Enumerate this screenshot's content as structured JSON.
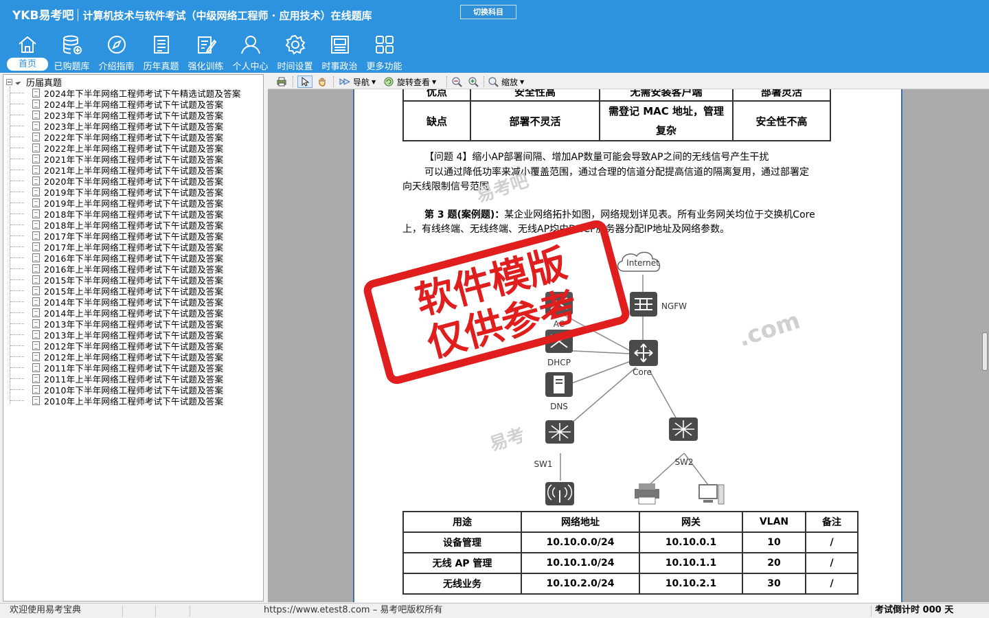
{
  "header": {
    "brand": "YKB易考吧",
    "title": "计算机技术与软件考试（中级网络工程师 · 应用技术）在线题库",
    "switch_label": "切换科目"
  },
  "nav": [
    {
      "label": "首页",
      "icon": "home-icon",
      "active": true
    },
    {
      "label": "已购题库",
      "icon": "database-icon"
    },
    {
      "label": "介绍指南",
      "icon": "compass-icon"
    },
    {
      "label": "历年真题",
      "icon": "exam-list-icon"
    },
    {
      "label": "强化训练",
      "icon": "edit-icon"
    },
    {
      "label": "个人中心",
      "icon": "user-icon"
    },
    {
      "label": "时间设置",
      "icon": "gear-icon"
    },
    {
      "label": "时事政治",
      "icon": "news-icon"
    },
    {
      "label": "更多功能",
      "icon": "grid-icon"
    }
  ],
  "tree": {
    "root": "历届真题",
    "items": [
      "2024年下半年网络工程师考试下午精选试题及答案",
      "2024年上半年网络工程师考试下午试题及答案",
      "2023年下半年网络工程师考试下午试题及答案",
      "2023年上半年网络工程师考试下午试题及答案",
      "2022年下半年网络工程师考试下午试题及答案",
      "2022年上半年网络工程师考试下午试题及答案",
      "2021年下半年网络工程师考试下午试题及答案",
      "2021年上半年网络工程师考试下午试题及答案",
      "2020年下半年网络工程师考试下午试题及答案",
      "2019年下半年网络工程师考试下午试题及答案",
      "2019年上半年网络工程师考试下午试题及答案",
      "2018年下半年网络工程师考试下午试题及答案",
      "2018年上半年网络工程师考试下午试题及答案",
      "2017年下半年网络工程师考试下午试题及答案",
      "2017年上半年网络工程师考试下午试题及答案",
      "2016年下半年网络工程师考试下午试题及答案",
      "2016年上半年网络工程师考试下午试题及答案",
      "2015年下半年网络工程师考试下午试题及答案",
      "2015年上半年网络工程师考试下午试题及答案",
      "2014年下半年网络工程师考试下午试题及答案",
      "2014年上半年网络工程师考试下午试题及答案",
      "2013年下半年网络工程师考试下午试题及答案",
      "2013年上半年网络工程师考试下午试题及答案",
      "2012年下半年网络工程师考试下午试题及答案",
      "2012年上半年网络工程师考试下午试题及答案",
      "2011年下半年网络工程师考试下午试题及答案",
      "2011年上半年网络工程师考试下午试题及答案",
      "2010年下半年网络工程师考试下午试题及答案",
      "2010年上半年网络工程师考试下午试题及答案"
    ]
  },
  "toolbar": {
    "nav_label": "导航",
    "rotate_label": "旋转查看",
    "zoom_label": "缩放"
  },
  "doc": {
    "compare_table": {
      "rows": [
        [
          "优点",
          "安全性高",
          "无需安装客户端",
          "部署灵活"
        ],
        [
          "缺点",
          "部署不灵活",
          "需登记 MAC 地址，管理复杂",
          "安全性不高"
        ]
      ]
    },
    "q4_line1": "【问题 4】缩小AP部署间隔、增加AP数量可能会导致AP之间的无线信号产生干扰",
    "q4_line2": "可以通过降低功率来减小覆盖范围，通过合理的信道分配提高信道的隔离复用，通过部署定",
    "q4_line3": "向天线限制信号范围",
    "q3_title": "第 3 题(案例题)：",
    "q3_text1": "某企业网络拓扑如图，网络规划详见表。所有业务网关均位于交换机Core",
    "q3_text2": "上，有线终端、无线终端、无线AP均由DHCP服务器分配IP地址及网络参数。",
    "topology_labels": {
      "internet": "Internet",
      "ngfw": "NGFW",
      "ac": "AC",
      "dhcp": "DHCP",
      "dns": "DNS",
      "core": "Core",
      "sw1": "SW1",
      "sw2": "SW2"
    },
    "net_table": {
      "headers": [
        "用途",
        "网络地址",
        "网关",
        "VLAN",
        "备注"
      ],
      "rows": [
        [
          "设备管理",
          "10.10.0.0/24",
          "10.10.0.1",
          "10",
          "/"
        ],
        [
          "无线 AP 管理",
          "10.10.1.0/24",
          "10.10.1.1",
          "20",
          "/"
        ],
        [
          "无线业务",
          "10.10.2.0/24",
          "10.10.2.1",
          "30",
          "/"
        ]
      ]
    },
    "stamp_line1": "软件模版",
    "stamp_line2": "仅供参考",
    "watermark1": "易考吧",
    "watermark2": ".com",
    "watermark3": "易考"
  },
  "status": {
    "welcome": "欢迎使用易考宝典",
    "copyright": "https://www.etest8.com – 易考吧版权所有",
    "countdown": "考试倒计时 000 天"
  },
  "colors": {
    "header_blue": "#2e93de",
    "stamp_red": "#e01e1e"
  }
}
